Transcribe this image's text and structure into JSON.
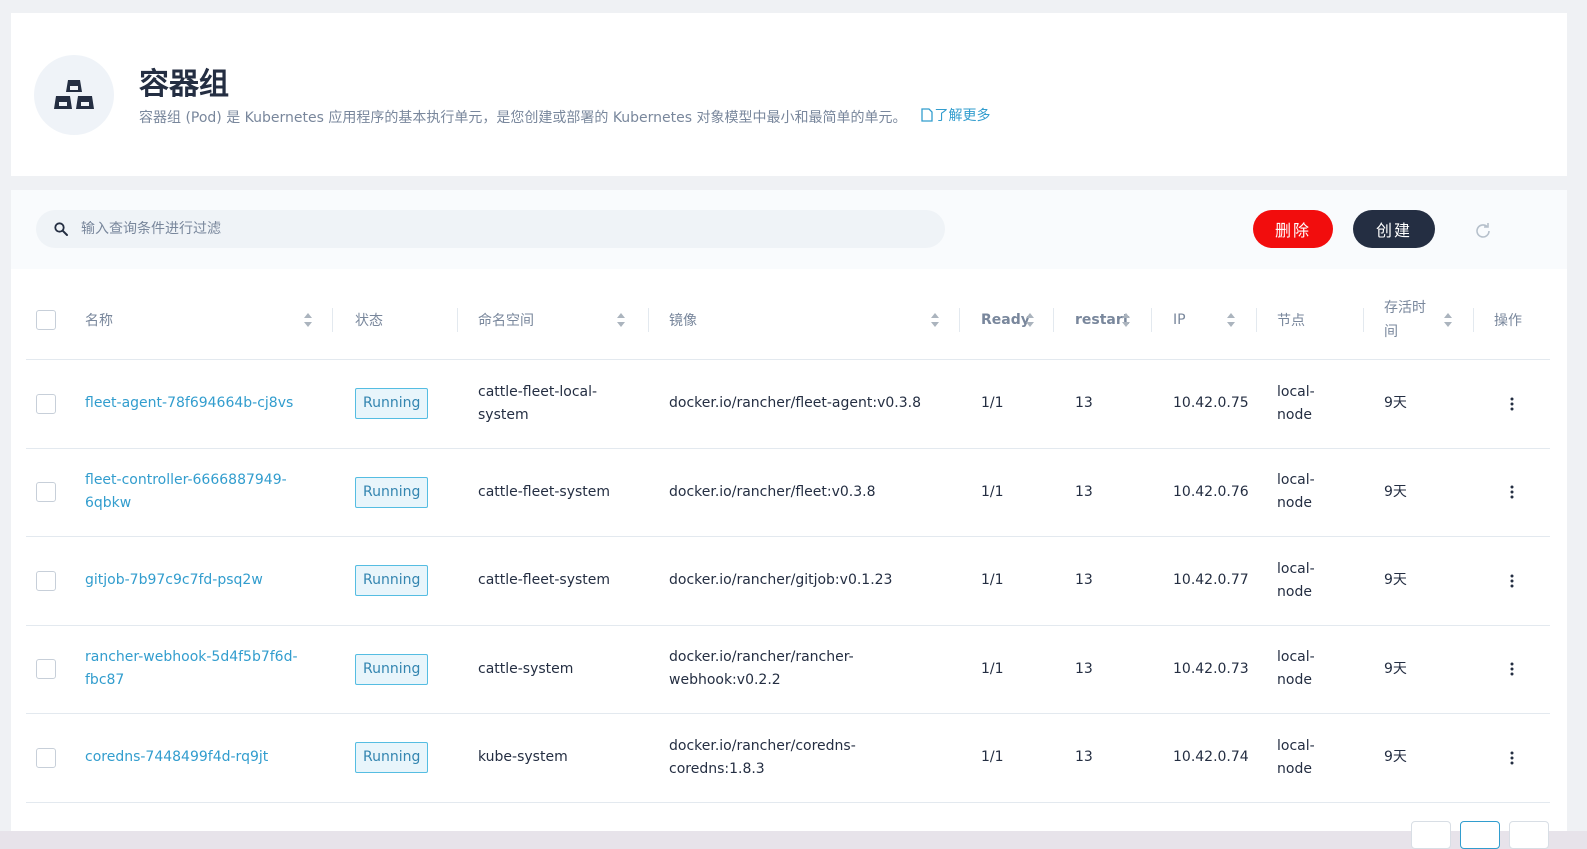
{
  "header": {
    "title": "容器组",
    "description": "容器组 (Pod) 是 Kubernetes 应用程序的基本执行单元，是您创建或部署的 Kubernetes 对象模型中最小和最简单的单元。",
    "learn_more": "了解更多",
    "icon": "pods-icon"
  },
  "toolbar": {
    "search_placeholder": "输入查询条件进行过滤",
    "delete_label": "删除",
    "create_label": "创建",
    "delete_color": "#f20d0d",
    "create_color": "#242e42"
  },
  "table": {
    "columns": {
      "name": "名称",
      "status": "状态",
      "namespace": "命名空间",
      "image": "镜像",
      "ready": "Ready",
      "restart": "restart",
      "ip": "IP",
      "node": "节点",
      "age": "存活时间",
      "actions": "操作"
    },
    "rows": [
      {
        "name_line1": "fleet-agent-78f694664b-cj8vs",
        "name_line2": "",
        "status": "Running",
        "ns_line1": "cattle-fleet-local-",
        "ns_line2": "system",
        "img_line1": "docker.io/rancher/fleet-agent:v0.3.8",
        "img_line2": "",
        "ready": "1/1",
        "restart": "13",
        "ip": "10.42.0.75",
        "node_line1": "local-",
        "node_line2": "node",
        "age": "9天"
      },
      {
        "name_line1": "fleet-controller-6666887949-",
        "name_line2": "6qbkw",
        "status": "Running",
        "ns_line1": "cattle-fleet-system",
        "ns_line2": "",
        "img_line1": "docker.io/rancher/fleet:v0.3.8",
        "img_line2": "",
        "ready": "1/1",
        "restart": "13",
        "ip": "10.42.0.76",
        "node_line1": "local-",
        "node_line2": "node",
        "age": "9天"
      },
      {
        "name_line1": "gitjob-7b97c9c7fd-psq2w",
        "name_line2": "",
        "status": "Running",
        "ns_line1": "cattle-fleet-system",
        "ns_line2": "",
        "img_line1": "docker.io/rancher/gitjob:v0.1.23",
        "img_line2": "",
        "ready": "1/1",
        "restart": "13",
        "ip": "10.42.0.77",
        "node_line1": "local-",
        "node_line2": "node",
        "age": "9天"
      },
      {
        "name_line1": "rancher-webhook-5d4f5b7f6d-",
        "name_line2": "fbc87",
        "status": "Running",
        "ns_line1": "cattle-system",
        "ns_line2": "",
        "img_line1": "docker.io/rancher/rancher-",
        "img_line2": "webhook:v0.2.2",
        "ready": "1/1",
        "restart": "13",
        "ip": "10.42.0.73",
        "node_line1": "local-",
        "node_line2": "node",
        "age": "9天"
      },
      {
        "name_line1": "coredns-7448499f4d-rq9jt",
        "name_line2": "",
        "status": "Running",
        "ns_line1": "kube-system",
        "ns_line2": "",
        "img_line1": "docker.io/rancher/coredns-coredns:1.8.3",
        "img_line2": "",
        "ready": "1/1",
        "restart": "13",
        "ip": "10.42.0.74",
        "node_line1": "local-",
        "node_line2": "node",
        "age": "9天"
      }
    ]
  },
  "icons": {
    "search": "search-icon",
    "refresh": "refresh-icon",
    "more": "more-vertical-icon",
    "doc": "document-icon",
    "sort": "sort-icon"
  }
}
